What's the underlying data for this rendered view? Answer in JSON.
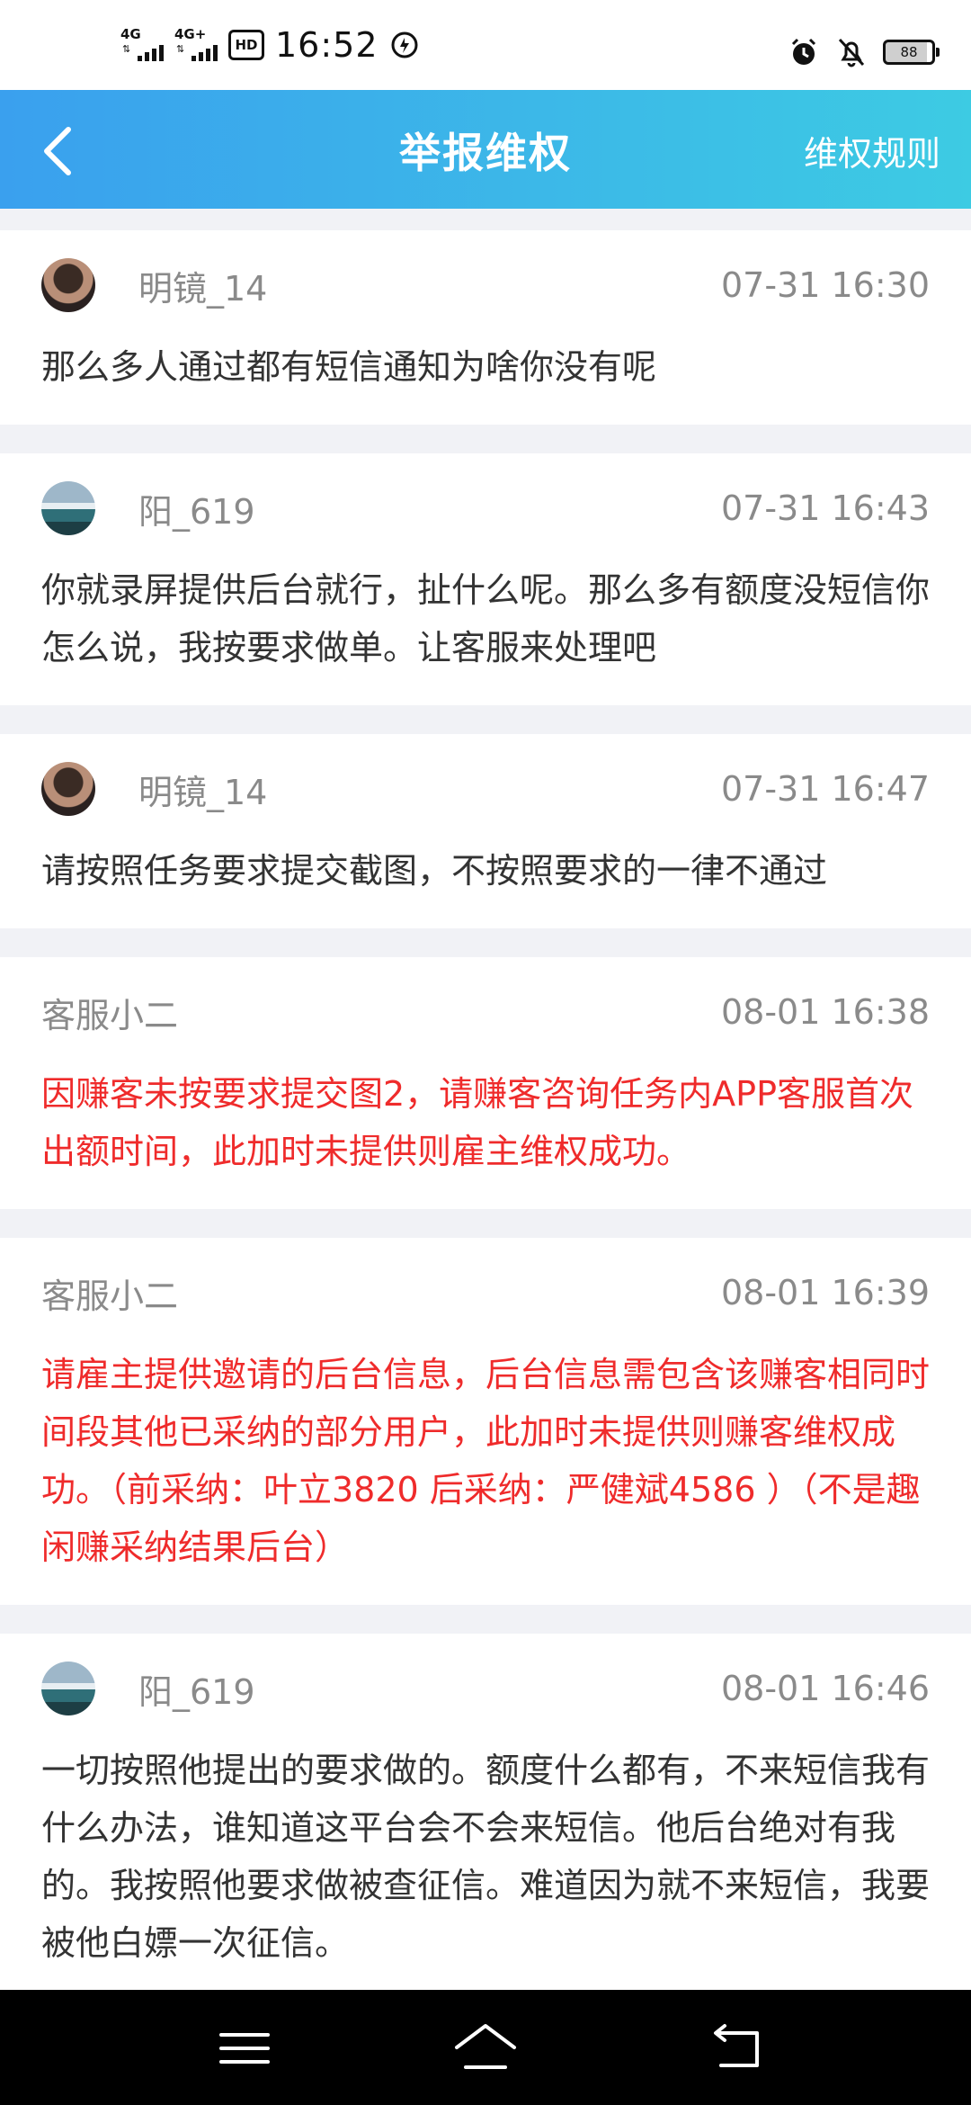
{
  "status_bar": {
    "net1": "4G",
    "net2": "4G+",
    "hd": "HD",
    "time": "16:52",
    "battery": "88"
  },
  "header": {
    "title": "举报维权",
    "rules_link": "维权规则"
  },
  "messages": [
    {
      "author": "明镜_14",
      "time": "07-31 16:30",
      "avatar": "person",
      "text": "那么多人通过都有短信通知为啥你没有呢"
    },
    {
      "author": "阳_619",
      "time": "07-31 16:43",
      "avatar": "landscape",
      "text": "你就录屏提供后台就行，扯什么呢。那么多有额度没短信你怎么说，我按要求做单。让客服来处理吧"
    },
    {
      "author": "明镜_14",
      "time": "07-31 16:47",
      "avatar": "person",
      "text": "请按照任务要求提交截图，不按照要求的一律不通过"
    },
    {
      "author": "客服小二",
      "time": "08-01 16:38",
      "avatar": "none",
      "text": "因赚客未按要求提交图2，请赚客咨询任务内APP客服首次出额时间，此加时未提供则雇主维权成功。"
    },
    {
      "author": "客服小二",
      "time": "08-01 16:39",
      "avatar": "none",
      "text": "请雇主提供邀请的后台信息，后台信息需包含该赚客相同时间段其他已采纳的部分用户，此加时未提供则赚客维权成功。（前采纳：叶立3820 后采纳：严健斌4586 ）（不是趣闲赚采纳结果后台）"
    },
    {
      "author": "阳_619",
      "time": "08-01 16:46",
      "avatar": "landscape",
      "text": "一切按照他提出的要求做的。额度什么都有，不来短信我有什么办法，谁知道这平台会不会来短信。他后台绝对有我的。我按照他要求做被查征信。难道因为就不来短信，我要被他白嫖一次征信。"
    }
  ],
  "colors": {
    "header_start": "#3aa0ee",
    "header_end": "#3dcbe3",
    "staff_text": "#ef2b2b",
    "meta_text": "#8a8a8a"
  },
  "icons": {
    "back": "chevron-left-icon",
    "menu": "menu-icon",
    "home": "home-icon",
    "return": "return-icon"
  }
}
